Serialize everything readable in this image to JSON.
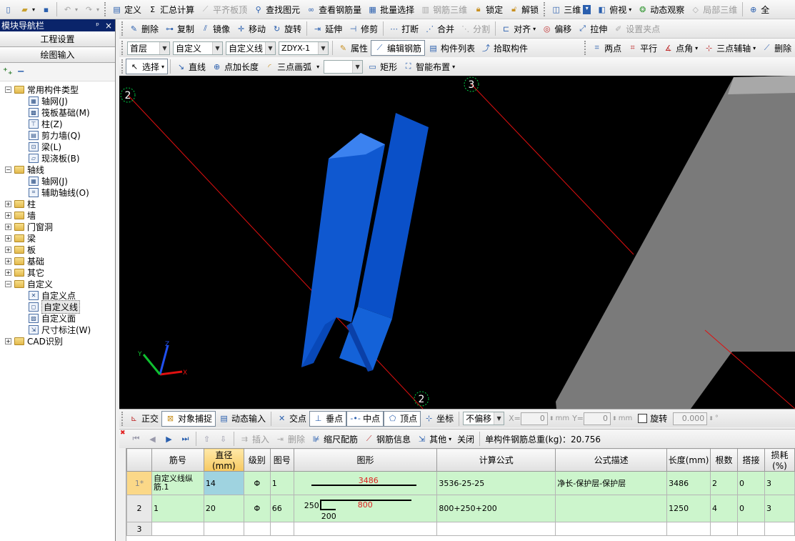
{
  "menu_row": {
    "items": [
      "定义",
      "汇总计算",
      "平齐板顶",
      "查找图元",
      "查看钢筋量",
      "批量选择",
      "钢筋三维",
      "锁定",
      "解锁",
      "三维",
      "俯视",
      "动态观察",
      "局部三维",
      "全"
    ],
    "disabled": [
      "平齐板顶",
      "钢筋三维",
      "局部三维"
    ]
  },
  "edit_row": {
    "items": [
      "删除",
      "复制",
      "镜像",
      "移动",
      "旋转",
      "延伸",
      "修剪",
      "打断",
      "合并",
      "分割",
      "对齐",
      "偏移",
      "拉伸",
      "设置夹点"
    ],
    "disabled": [
      "分割",
      "设置夹点"
    ]
  },
  "prop_row": {
    "floor": "首层",
    "category": "自定义",
    "type": "自定义线",
    "name": "ZDYX-1",
    "buttons": [
      "属性",
      "编辑钢筋",
      "构件列表",
      "拾取构件"
    ],
    "right": [
      "两点",
      "平行",
      "点角",
      "三点辅轴",
      "删除"
    ]
  },
  "draw_row": {
    "select": "选择",
    "line": "直线",
    "point_length": "点加长度",
    "arc": "三点画弧",
    "blank_combo": "",
    "rect": "矩形",
    "smart": "智能布置"
  },
  "nav": {
    "title": "模块导航栏",
    "pin": "ᵖ",
    "close": "×",
    "btn_project": "工程设置",
    "btn_draw": "绘图输入",
    "tree": [
      {
        "level": 0,
        "exp": "−",
        "folder": true,
        "label": "常用构件类型"
      },
      {
        "level": 1,
        "icon": "grid",
        "label": "轴网(J)"
      },
      {
        "level": 1,
        "icon": "raft",
        "label": "筏板基础(M)"
      },
      {
        "level": 1,
        "icon": "col",
        "label": "柱(Z)"
      },
      {
        "level": 1,
        "icon": "wall",
        "label": "剪力墙(Q)"
      },
      {
        "level": 1,
        "icon": "beam",
        "label": "梁(L)"
      },
      {
        "level": 1,
        "icon": "slab",
        "label": "现浇板(B)"
      },
      {
        "level": 0,
        "exp": "−",
        "folder": true,
        "label": "轴线"
      },
      {
        "level": 1,
        "icon": "grid",
        "label": "轴网(J)"
      },
      {
        "level": 1,
        "icon": "aux",
        "label": "辅助轴线(O)"
      },
      {
        "level": 0,
        "exp": "+",
        "folder": true,
        "label": "柱"
      },
      {
        "level": 0,
        "exp": "+",
        "folder": true,
        "label": "墙"
      },
      {
        "level": 0,
        "exp": "+",
        "folder": true,
        "label": "门窗洞"
      },
      {
        "level": 0,
        "exp": "+",
        "folder": true,
        "label": "梁"
      },
      {
        "level": 0,
        "exp": "+",
        "folder": true,
        "label": "板"
      },
      {
        "level": 0,
        "exp": "+",
        "folder": true,
        "label": "基础"
      },
      {
        "level": 0,
        "exp": "+",
        "folder": true,
        "label": "其它"
      },
      {
        "level": 0,
        "exp": "−",
        "folder": true,
        "label": "自定义"
      },
      {
        "level": 1,
        "icon": "pt",
        "label": "自定义点"
      },
      {
        "level": 1,
        "icon": "ln",
        "label": "自定义线",
        "selected": true
      },
      {
        "level": 1,
        "icon": "face",
        "label": "自定义面"
      },
      {
        "level": 1,
        "icon": "dim",
        "label": "尺寸标注(W)"
      },
      {
        "level": 0,
        "exp": "+",
        "folder": true,
        "label": "CAD识别"
      }
    ]
  },
  "viewport": {
    "axis_labels": [
      "2",
      "3",
      "2"
    ],
    "axis_xyz": [
      "X",
      "Y",
      "Z"
    ]
  },
  "snap_bar": {
    "items": [
      "正交",
      "对象捕捉",
      "动态输入",
      "交点",
      "垂点",
      "中点",
      "顶点",
      "坐标"
    ],
    "offset": "不偏移",
    "x_label": "X=",
    "x_val": "0",
    "y_label": "Y=",
    "y_val": "0",
    "unit": "mm",
    "rotate": "旋转",
    "rot_val": "0.000",
    "deg": "°"
  },
  "rebar_bar": {
    "insert": "插入",
    "delete": "删除",
    "scale": "缩尺配筋",
    "info": "钢筋信息",
    "other": "其他",
    "close": "关闭",
    "total": "单构件钢筋总重(kg)：20.756"
  },
  "grid": {
    "headers": [
      "筋号",
      "直径(mm)",
      "级别",
      "图号",
      "图形",
      "计算公式",
      "公式描述",
      "长度(mm)",
      "根数",
      "搭接",
      "损耗(%)"
    ],
    "rows": [
      {
        "no": "1*",
        "name": "自定义线纵筋.1",
        "dia": "14",
        "grade": "Φ",
        "fig": "1",
        "shape_val": "3486",
        "formula": "3536-25-25",
        "desc": "净长-保护层-保护层",
        "length": "3486",
        "count": "2",
        "lap": "0",
        "loss": "3"
      },
      {
        "no": "2",
        "name": "1",
        "dia": "20",
        "grade": "Φ",
        "fig": "66",
        "shape_a": "250",
        "shape_b": "800",
        "shape_c": "200",
        "formula": "800+250+200",
        "desc": "",
        "length": "1250",
        "count": "4",
        "lap": "0",
        "loss": "3"
      },
      {
        "no": "3",
        "name": "",
        "dia": "",
        "grade": "",
        "fig": "",
        "formula": "",
        "desc": "",
        "length": "",
        "count": "",
        "lap": "",
        "loss": ""
      }
    ]
  }
}
